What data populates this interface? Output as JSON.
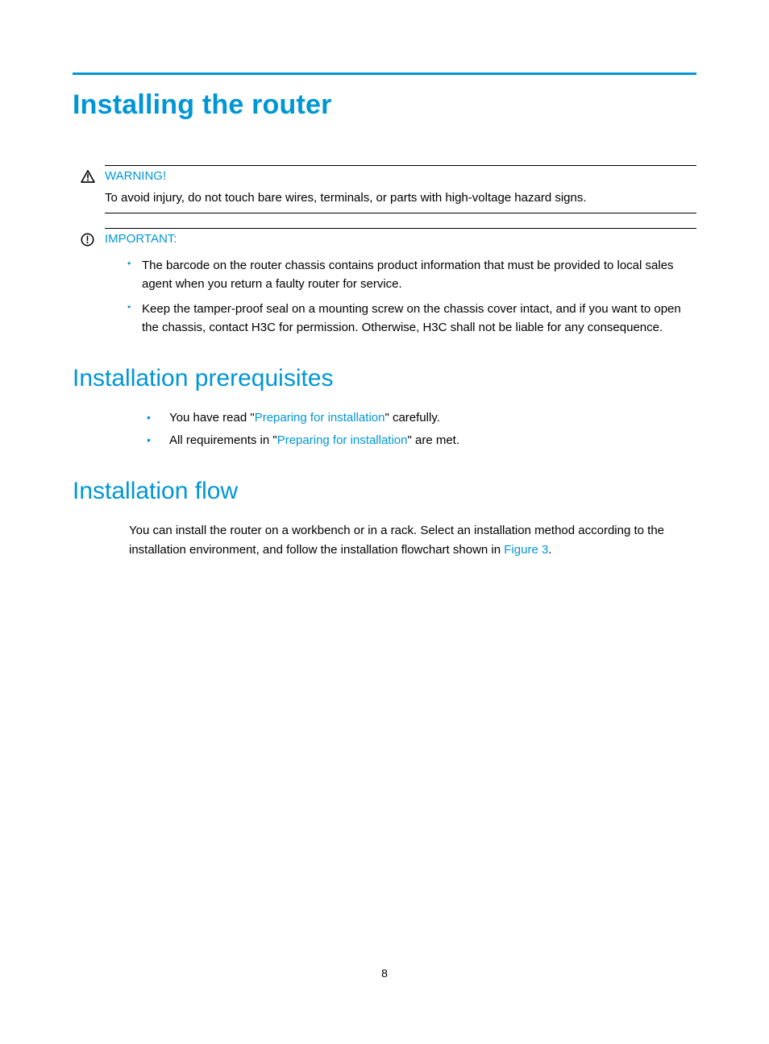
{
  "page": {
    "title": "Installing the router",
    "number": "8"
  },
  "warning": {
    "label": "WARNING!",
    "text": "To avoid injury, do not touch bare wires, terminals, or parts with high-voltage hazard signs."
  },
  "important": {
    "label": "IMPORTANT:",
    "bullets": [
      "The barcode on the router chassis contains product information that must be provided to local sales agent when you return a faulty router for service.",
      "Keep the tamper-proof seal on a mounting screw on the chassis cover intact, and if you want to open the chassis, contact H3C for permission. Otherwise, H3C shall not be liable for any consequence."
    ]
  },
  "sections": {
    "prereq": {
      "heading": "Installation prerequisites",
      "items": [
        {
          "pre": "You have read \"",
          "link": "Preparing for installation",
          "post": "\" carefully."
        },
        {
          "pre": "All requirements in \"",
          "link": "Preparing for installation",
          "post": "\" are met."
        }
      ]
    },
    "flow": {
      "heading": "Installation flow",
      "para_pre": "You can install the router on a workbench or in a rack. Select an installation method according to the installation environment, and follow the installation flowchart shown in ",
      "para_link": "Figure 3",
      "para_post": "."
    }
  }
}
